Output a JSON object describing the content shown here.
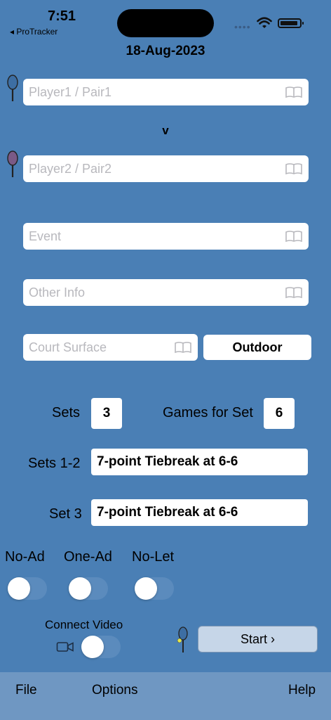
{
  "status": {
    "time": "7:51",
    "back_label": "◂ ProTracker",
    "dots": "••••"
  },
  "date": "18-Aug-2023",
  "player1": {
    "placeholder": "Player1 / Pair1"
  },
  "versus": "v",
  "player2": {
    "placeholder": "Player2 / Pair2"
  },
  "event": {
    "placeholder": "Event"
  },
  "other_info": {
    "placeholder": "Other Info"
  },
  "court_surface": {
    "placeholder": "Court Surface"
  },
  "venue_button": "Outdoor",
  "sets": {
    "label": "Sets",
    "value": "3"
  },
  "games_for_set": {
    "label": "Games for Set",
    "value": "6"
  },
  "sets_1_2": {
    "label": "Sets 1-2",
    "value": "7-point Tiebreak at 6-6"
  },
  "set_3": {
    "label": "Set 3",
    "value": "7-point Tiebreak at 6-6"
  },
  "toggles": [
    {
      "label": "No-Ad",
      "on": false
    },
    {
      "label": "One-Ad",
      "on": false
    },
    {
      "label": "No-Let",
      "on": false
    }
  ],
  "connect_video": {
    "label": "Connect Video",
    "on": false
  },
  "start_button": "Start ›",
  "menu": {
    "file": "File",
    "options": "Options",
    "help": "Help"
  },
  "colors": {
    "background": "#4a7fb5",
    "bottom_bar": "#6f97c2",
    "start_button": "#c6d6e8"
  }
}
